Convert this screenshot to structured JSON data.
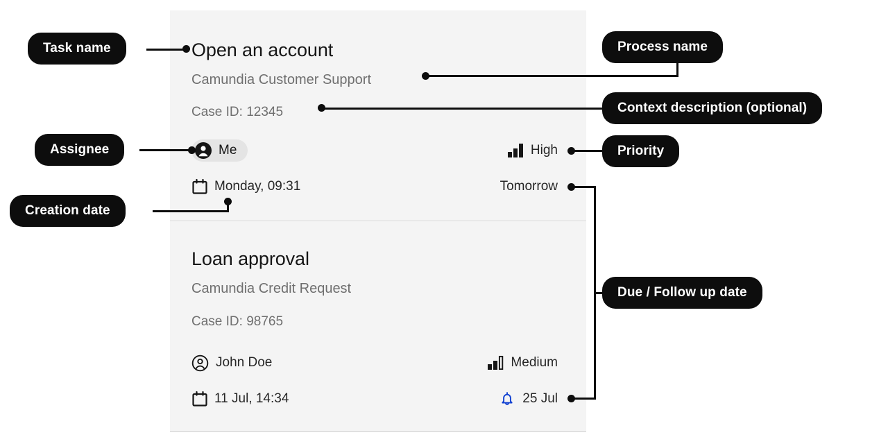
{
  "panel": {
    "cards": [
      {
        "task_name": "Open an account",
        "process_name": "Camundia Customer Support",
        "context_description": "Case ID: 12345",
        "assignee": "Me",
        "assignee_style": "chip",
        "assignee_icon": "user-filled-icon",
        "priority": "High",
        "priority_icon": "priority-bars-high-icon",
        "priority_level": 3,
        "creation_date": "Monday, 09:31",
        "creation_icon": "calendar-icon",
        "due_date": "Tomorrow",
        "due_icon": "none"
      },
      {
        "task_name": "Loan approval",
        "process_name": "Camundia Credit Request",
        "context_description": "Case ID: 98765",
        "assignee": "John Doe",
        "assignee_style": "plain",
        "assignee_icon": "user-outline-icon",
        "priority": "Medium",
        "priority_icon": "priority-bars-medium-icon",
        "priority_level": 2,
        "creation_date": "11 Jul, 14:34",
        "creation_icon": "calendar-icon",
        "due_date": "25 Jul",
        "due_icon": "bell-icon"
      }
    ]
  },
  "annotations": {
    "task_name": "Task name",
    "assignee": "Assignee",
    "creation_date": "Creation date",
    "process_name": "Process name",
    "context_description": "Context description (optional)",
    "priority": "Priority",
    "due_follow_up": "Due / Follow up date"
  },
  "colors": {
    "panel_bg": "#f4f4f4",
    "annotation_bg": "#0d0d0d",
    "annotation_text": "#ffffff",
    "title_text": "#161616",
    "muted_text": "#6f6f6f",
    "bell_blue": "#0f3fd1"
  }
}
